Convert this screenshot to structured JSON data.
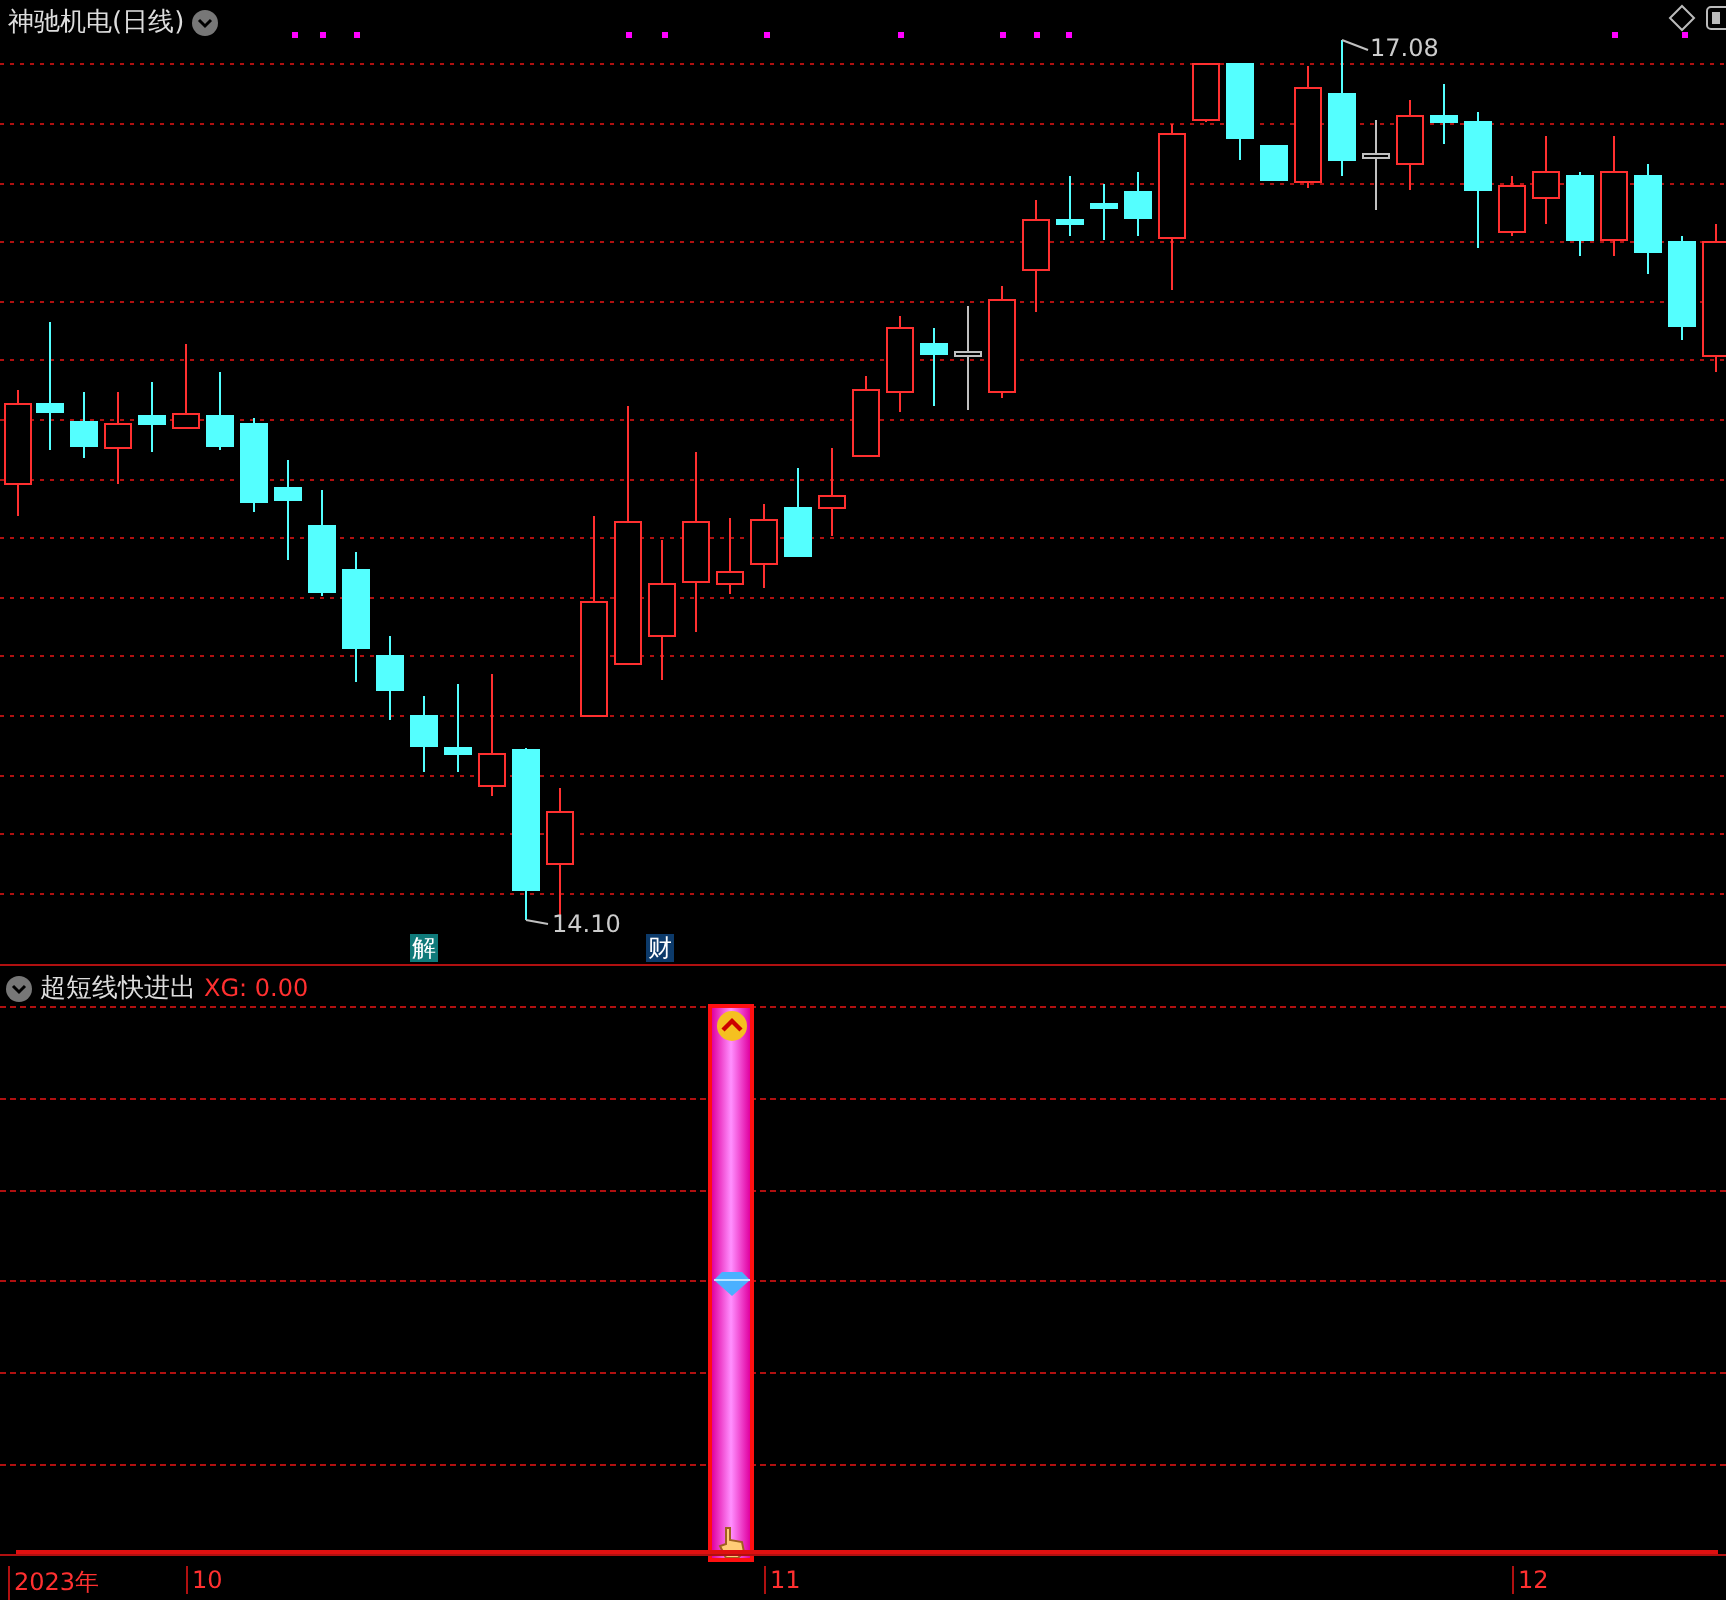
{
  "chart_panel": {
    "title": "神驰机电(日线)",
    "high_label": "17.08",
    "low_label": "14.10",
    "markers": [
      {
        "label": "解",
        "color": "#0f7a7a"
      },
      {
        "label": "财",
        "color": "#0c3a6a"
      }
    ]
  },
  "indicator_panel": {
    "title": "超短线快进出",
    "reading": "XG: 0.00"
  },
  "time_axis": {
    "labels": [
      "2023年",
      "10",
      "11",
      "12"
    ]
  }
}
